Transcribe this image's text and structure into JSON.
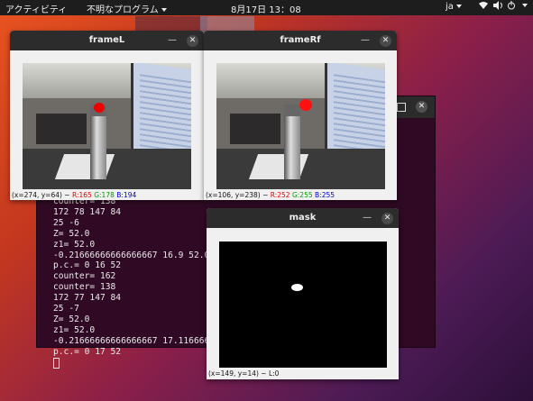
{
  "topbar": {
    "activities": "アクティビティ",
    "app_menu": "不明なプログラム",
    "clock": "8月17日  13：08",
    "language": "ja"
  },
  "terminal": {
    "lines": [
      "counter= 138",
      "172 78 147 84",
      "25 -6",
      "Z= 52.0",
      "z1= 52.0",
      "-0.21666666666666667 16.9 52.0",
      "p.c.= 0 16 52",
      "counter= 162",
      "counter= 138",
      "172 77 147 84",
      "25 -7",
      "Z= 52.0",
      "z1= 52.0",
      "-0.21666666666666667 17.1166666",
      "p.c.= 0 17 52"
    ]
  },
  "frameL": {
    "title": "frameL",
    "status_prefix": "(x=274, y=64) ~ ",
    "r": "R:165",
    "g": "G:178",
    "b": "B:194"
  },
  "frameRf": {
    "title": "frameRf",
    "status_prefix": "(x=106, y=238) ~ ",
    "r": "R:252",
    "g": "G:255",
    "b": "B:255"
  },
  "mask": {
    "title": "mask",
    "status": "(x=149, y=14) ~ L:0"
  },
  "icons": {
    "minimize": "—",
    "close": "✕"
  }
}
